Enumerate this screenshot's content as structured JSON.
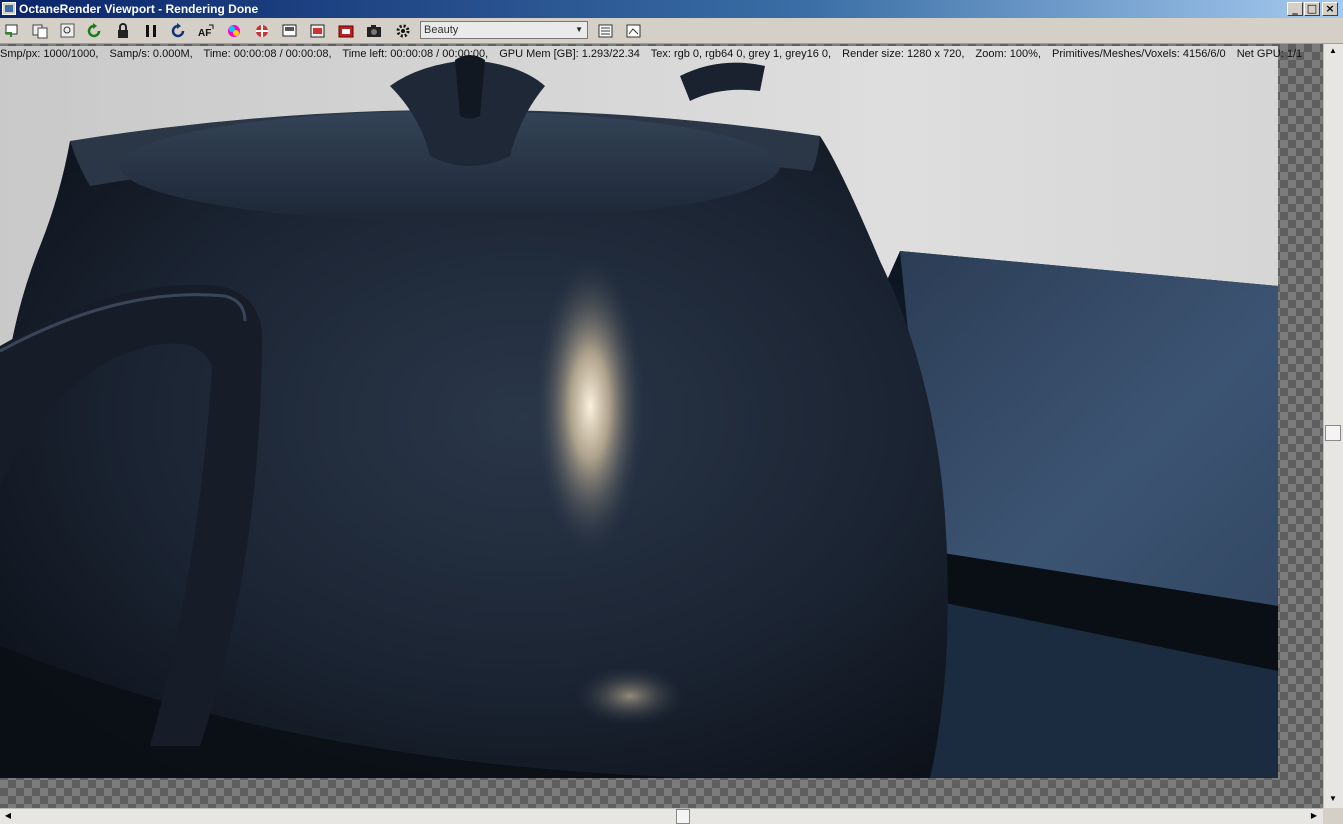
{
  "window": {
    "title": "OctaneRender Viewport - Rendering Done",
    "controls": [
      "_",
      "□",
      "×"
    ]
  },
  "toolbar": {
    "buttons": [
      "send-scene-icon",
      "copy-icon",
      "zoom-icon",
      "restart-render-icon",
      "lock-icon",
      "pause-icon",
      "reset-camera-icon",
      "autofocus-icon",
      "color-picker-icon",
      "clay-mode-icon",
      "region-render-icon",
      "film-region-icon",
      "save-render-icon",
      "camera-snapshot-icon",
      "settings-gear-icon"
    ],
    "pass_selector": {
      "value": "Beauty"
    },
    "extra_buttons": [
      "list-view-icon",
      "image-view-icon"
    ]
  },
  "status": {
    "samples": "Smp/px: 1000/1000,",
    "samples_per_sec": "Samp/s: 0.000M,",
    "time": "Time: 00:00:08 / 00:00:08,",
    "time_left": "Time left: 00:00:08 / 00:00:00,",
    "gpu_mem": "GPU Mem [GB]: 1.293/22.34",
    "textures": "Tex: rgb 0, rgb64 0, grey 1, grey16 0,",
    "render_size": "Render size: 1280 x 720,",
    "zoom": "Zoom: 100%,",
    "primitives": "Primitives/Meshes/Voxels: 4156/6/0",
    "net_gpu": "Net GPU: 1/1"
  },
  "colors": {
    "title_bar": "#0a246a",
    "toolbar_bg": "#d4d0c8",
    "teapot": "#1b2433",
    "backdrop": "#d8d8d8",
    "box_top": "#3a4f6b"
  }
}
